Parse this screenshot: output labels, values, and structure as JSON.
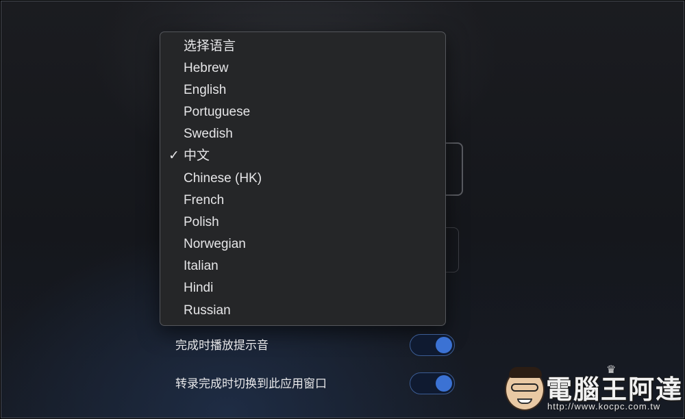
{
  "language_menu": {
    "items": [
      {
        "label": "选择语言",
        "checked": false
      },
      {
        "label": "Hebrew",
        "checked": false
      },
      {
        "label": "English",
        "checked": false
      },
      {
        "label": "Portuguese",
        "checked": false
      },
      {
        "label": "Swedish",
        "checked": false
      },
      {
        "label": "中文",
        "checked": true
      },
      {
        "label": "Chinese (HK)",
        "checked": false
      },
      {
        "label": "French",
        "checked": false
      },
      {
        "label": "Polish",
        "checked": false
      },
      {
        "label": "Norwegian",
        "checked": false
      },
      {
        "label": "Italian",
        "checked": false
      },
      {
        "label": "Hindi",
        "checked": false
      },
      {
        "label": "Russian",
        "checked": false
      }
    ],
    "check_glyph": "✓"
  },
  "settings": [
    {
      "label": "完成时播放提示音",
      "enabled": true
    },
    {
      "label": "转录完成时切换到此应用窗口",
      "enabled": true
    }
  ],
  "watermark": {
    "title": "電腦王阿達",
    "url": "http://www.kocpc.com.tw",
    "crown_icon": "crown-icon"
  },
  "colors": {
    "toggle_on": "#3b72d4",
    "menu_bg": "#252628"
  }
}
